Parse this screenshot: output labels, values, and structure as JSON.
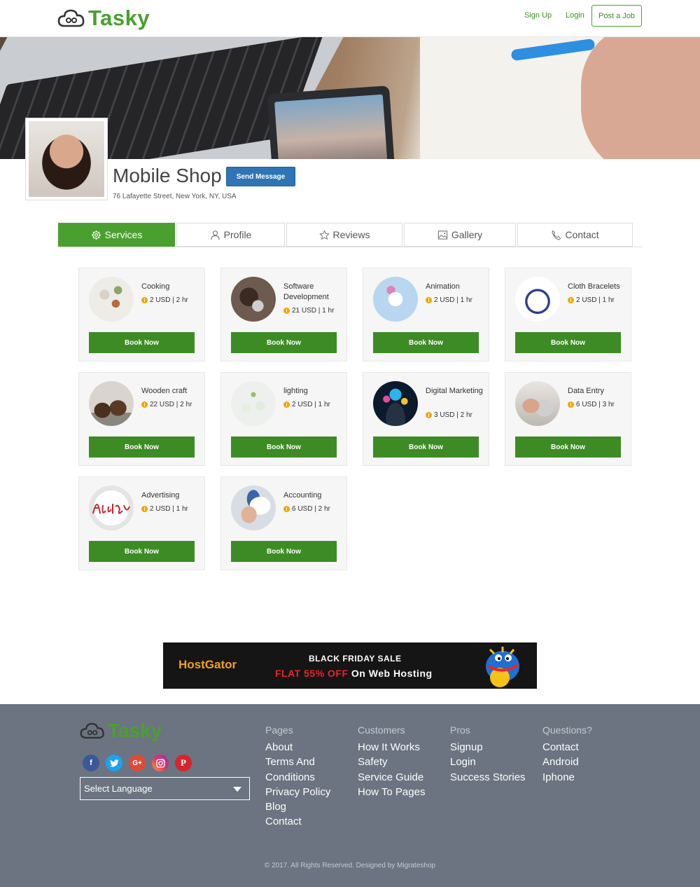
{
  "header": {
    "logo_text": "Tasky",
    "sign_up": "Sign Up",
    "login": "Login",
    "post_job": "Post a Job"
  },
  "profile": {
    "title": "Mobile Shop",
    "send_message": "Send Message",
    "address": "76 Lafayette Street, New York, NY, USA"
  },
  "tabs": [
    {
      "label": "Services",
      "icon": "gear-icon"
    },
    {
      "label": "Profile",
      "icon": "user-icon"
    },
    {
      "label": "Reviews",
      "icon": "star-icon"
    },
    {
      "label": "Gallery",
      "icon": "image-icon"
    },
    {
      "label": "Contact",
      "icon": "phone-icon"
    }
  ],
  "services": [
    {
      "name": "Cooking",
      "price": "2 USD | 2 hr",
      "book": "Book Now"
    },
    {
      "name": "Software Development",
      "price": "21 USD | 1 hr",
      "book": "Book Now"
    },
    {
      "name": "Animation",
      "price": "2 USD | 1 hr",
      "book": "Book Now"
    },
    {
      "name": "Cloth Bracelets",
      "price": "2 USD | 1 hr",
      "book": "Book Now"
    },
    {
      "name": "Wooden craft",
      "price": "22 USD | 2 hr",
      "book": "Book Now"
    },
    {
      "name": "lighting",
      "price": "2 USD | 1 hr",
      "book": "Book Now"
    },
    {
      "name": "Digital Marketing",
      "price": "3 USD | 2 hr",
      "book": "Book Now"
    },
    {
      "name": "Data Entry",
      "price": "6 USD | 3 hr",
      "book": "Book Now"
    },
    {
      "name": "Advertising",
      "price": "2 USD | 1 hr",
      "book": "Book Now"
    },
    {
      "name": "Accounting",
      "price": "6 USD | 2 hr",
      "book": "Book Now"
    }
  ],
  "ad": {
    "brand": "HostGator",
    "line1": "BLACK FRIDAY SALE",
    "line2_red": "FLAT 55% OFF",
    "line2_rest": "On Web Hosting"
  },
  "footer": {
    "logo_text": "Tasky",
    "social": [
      "facebook-icon",
      "twitter-icon",
      "google-plus-icon",
      "instagram-icon",
      "pinterest-icon"
    ],
    "language": "Select Language",
    "columns": [
      {
        "heading": "Pages",
        "items": [
          "About",
          "Terms And",
          "Conditions",
          "Privacy Policy",
          "Blog",
          "Contact"
        ]
      },
      {
        "heading": "Customers",
        "items": [
          "How It Works",
          "Safety",
          "Service Guide",
          "How To Pages"
        ]
      },
      {
        "heading": "Pros",
        "items": [
          "Signup",
          "Login",
          "Success Stories"
        ]
      },
      {
        "heading": "Questions?",
        "items": [
          "Contact",
          "Android",
          "Iphone"
        ]
      }
    ],
    "copyright": "© 2017. All Rights Reserved. Designed by Migrateshop"
  },
  "colors": {
    "brand_green": "#49a02e",
    "button_green": "#3d8b24",
    "message_blue": "#2f74b5",
    "footer_bg": "#6b7480"
  }
}
